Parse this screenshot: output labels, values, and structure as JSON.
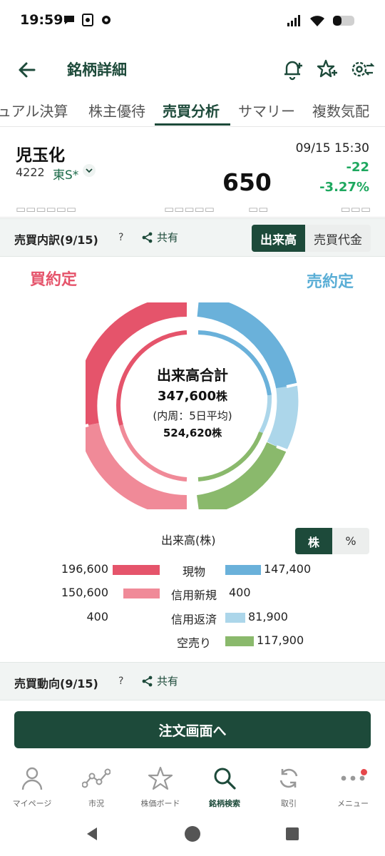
{
  "status": {
    "time": "19:59"
  },
  "app_bar": {
    "title": "銘柄詳細"
  },
  "tabs": [
    {
      "label": "ュアル決算"
    },
    {
      "label": "株主優待"
    },
    {
      "label": "売買分析"
    },
    {
      "label": "サマリー"
    },
    {
      "label": "複数気配"
    }
  ],
  "stock": {
    "name": "児玉化",
    "code": "4222",
    "market": "東S*",
    "datetime": "09/15 15:30",
    "price": "650",
    "change": "-22",
    "change_pct": "-3.27%"
  },
  "breakdown": {
    "title": "売買内訳(9/15)",
    "help": "?",
    "share": "共有",
    "toggle": [
      "出来高",
      "売買代金"
    ],
    "buy_label": "買約定",
    "sell_label": "売約定",
    "center": {
      "title": "出来高合計",
      "total": "347,600",
      "unit": "株",
      "sub": "(内周：5日平均)",
      "avg": "524,620"
    },
    "unit_label": "出来高(株)",
    "unit_toggle": [
      "株",
      "%"
    ],
    "rows": [
      {
        "buy": "196,600",
        "category": "現物",
        "sell": "147,400"
      },
      {
        "buy": "150,600",
        "category": "信用新規",
        "sell": "400"
      },
      {
        "buy": "400",
        "category": "信用返済",
        "sell": "81,900"
      },
      {
        "buy": "",
        "category": "空売り",
        "sell": "117,900"
      }
    ]
  },
  "trend": {
    "title": "売買動向(9/15)",
    "help": "?",
    "share": "共有"
  },
  "order_button": "注文画面へ",
  "bottom_nav": [
    {
      "label": "マイページ"
    },
    {
      "label": "市況"
    },
    {
      "label": "株価ボード"
    },
    {
      "label": "銘柄検索"
    },
    {
      "label": "取引"
    },
    {
      "label": "メニュー"
    }
  ],
  "colors": {
    "brand": "#1d4a3a",
    "buy_spot": "#e5546b",
    "buy_margin": "#f08a98",
    "sell_spot": "#6ab1da",
    "sell_margin_close": "#acd6ea",
    "short": "#8ab96c",
    "down": "#1ea85f"
  }
}
